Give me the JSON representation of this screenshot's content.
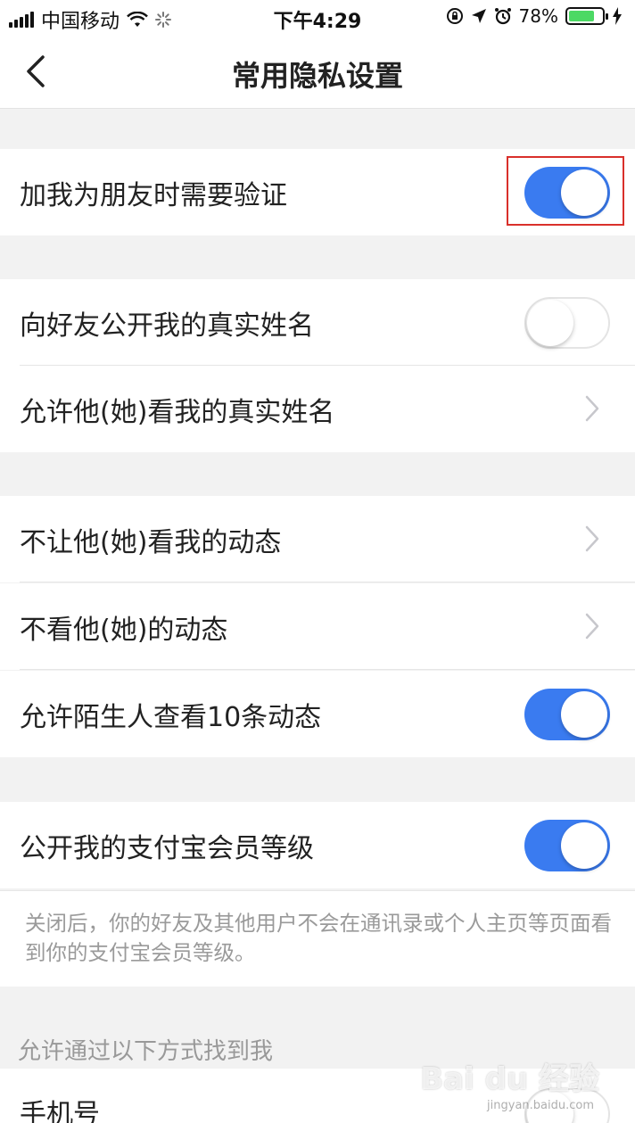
{
  "status_bar": {
    "carrier": "中国移动",
    "time": "下午4:29",
    "battery_percent": "78%",
    "battery_level": 0.78,
    "icons": [
      "signal-icon",
      "wifi-icon",
      "loading-icon",
      "orientation-lock-icon",
      "location-icon",
      "alarm-icon",
      "battery-icon",
      "charging-icon"
    ]
  },
  "nav": {
    "title": "常用隐私设置",
    "back_icon": "chevron-left-icon"
  },
  "settings": {
    "verify_friend": {
      "label": "加我为朋友时需要验证",
      "toggle": "on"
    },
    "show_real_name": {
      "label": "向好友公开我的真实姓名",
      "toggle": "off"
    },
    "allow_see_real_name": {
      "label": "允许他(她)看我的真实姓名"
    },
    "hide_my_feed": {
      "label": "不让他(她)看我的动态"
    },
    "hide_their_feed": {
      "label": "不看他(她)的动态"
    },
    "stranger_feed": {
      "label": "允许陌生人查看10条动态",
      "toggle": "on"
    },
    "member_level": {
      "label": "公开我的支付宝会员等级",
      "toggle": "on"
    },
    "member_note": "关闭后，你的好友及其他用户不会在通讯录或个人主页等页面看到你的支付宝会员等级。",
    "find_me_header": "允许通过以下方式找到我",
    "phone": {
      "label": "手机号",
      "toggle": "off"
    }
  },
  "colors": {
    "accent": "#3a7bf0",
    "highlight": "#d9302b",
    "background": "#f2f2f2"
  },
  "watermark": {
    "brand": "Bai du 经验",
    "site": "jingyan.baidu.com"
  }
}
